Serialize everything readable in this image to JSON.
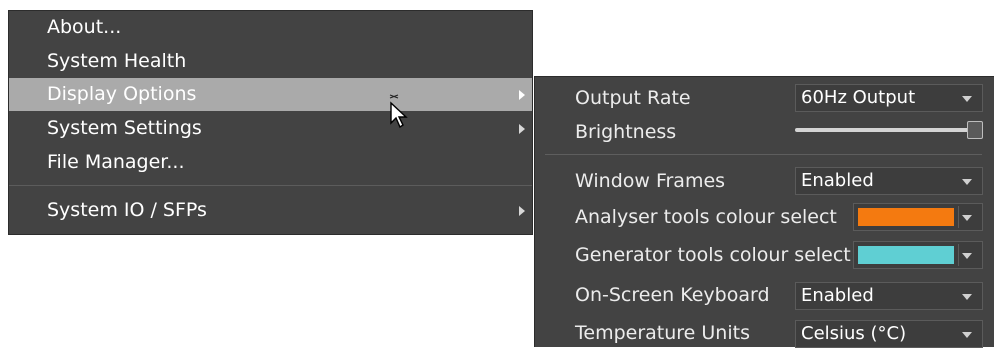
{
  "main_menu": {
    "items": [
      {
        "label": "About...",
        "submenu": false
      },
      {
        "label": "System Health",
        "submenu": false
      },
      {
        "label": "Display Options",
        "submenu": true,
        "active": true
      },
      {
        "label": "System Settings",
        "submenu": true
      },
      {
        "label": "File Manager...",
        "submenu": false
      },
      {
        "label": "System IO / SFPs",
        "submenu": true
      }
    ]
  },
  "display_options": {
    "output_rate": {
      "label": "Output Rate",
      "value": "60Hz Output"
    },
    "brightness": {
      "label": "Brightness",
      "level": 1.0
    },
    "window_frames": {
      "label": "Window Frames",
      "value": "Enabled"
    },
    "analyser_colour": {
      "label": "Analyser tools colour select",
      "color": "#f47a10"
    },
    "generator_colour": {
      "label": "Generator tools colour select",
      "color": "#5fcfd3"
    },
    "onscreen_keyboard": {
      "label": "On-Screen Keyboard",
      "value": "Enabled"
    },
    "temperature_units": {
      "label": "Temperature Units",
      "value": "Celsius (°C)"
    }
  },
  "colors": {
    "menu_bg": "#434343",
    "highlight": "#aaaaaa"
  }
}
